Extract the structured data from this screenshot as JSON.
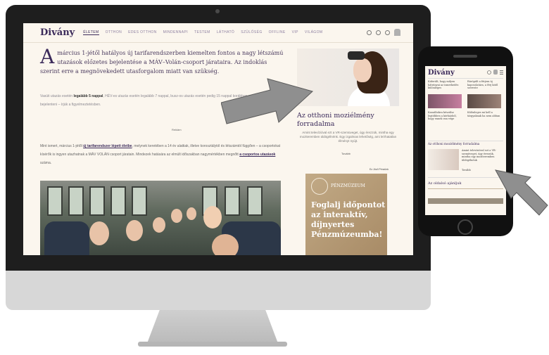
{
  "site": {
    "logo": "Divány",
    "nav_items": [
      "ÉLETEM",
      "OTTHON",
      "EDES OTTHON",
      "MINDENNAPI",
      "TESTEM",
      "LÁTHATÓ",
      "SZÜLŐSÉG",
      "OFFLINE",
      "VIP",
      "VILÁGOM"
    ],
    "active_nav": "ÉLETEM"
  },
  "article": {
    "dropcap": "A",
    "lead": "március 1-jétől hatályos új tarifarendszerben kiemelten fontos a nagy létszámú utazások előzetes bejelentése a MÁV–Volán-csoport járataira. Az indoklás szerint erre a megnövekedett utasforgalom miatt van szükség.",
    "para1_pre": "Vasúti utazás esetén ",
    "para1_bold": "legalább 5 nappal",
    "para1_post": ", HÉV-es utazás esetén legalább 7 nappal, busz-os utazás esetén pedig 15 nappal korábban szükségeses bejelenteni – írják a figyelmeztetésben.",
    "caption": "Reklám",
    "para2_a": "Mint ismert, március 1-jétől ",
    "para2_link1": "új tarifarendszer lépett életbe",
    "para2_b": ", melynek keretében a 14 év alattiak, illetve korosztálytól és létszámtól függően – a csoportokat kísérők is ingyen utazhatnak a MÁV VOLÁN csoport járatain. Mindezek hatására az elmúlt időszakban nagymértékben megnőtt ",
    "para2_link2": "a csoportos utazások",
    "para2_c": " száma."
  },
  "feature": {
    "title": "Az otthoni moziélmény forradalma",
    "text": "Amint televízióval ezt a VR-szemüveget, úgy érezzük, mintha egy moziteremben üldögélnénk. Egy izgalmas lehetőség, ami leírhatatlan élményt nyújt.",
    "more": "Tovább",
    "sponsor": "Ez Jövő Pénzünk"
  },
  "ad": {
    "brand": "PÉNZMÚZEUM",
    "headline": "Foglalj időpontot az interaktív, díjnyertes Pénzmúzeumba!"
  },
  "phone": {
    "logo": "Divány",
    "item1": "Kiderült, hogy milyen hátrányai az ismerkedés különleges",
    "item2": "Ráröpült a férjem új kapcsolatára, a férj kitől szerezte",
    "item3": "Kaszáltokra készülsz legtöbben a kórházból, hogy ennek van vége",
    "item4": "Különleges mi kell a tárgyaknak ha nem abban",
    "feature_label": "Az otthoni moziélmény forradalma",
    "feature_text": "Amint televízióval ezt a VR-szemüveget, úgy érezzük, mintha egy moziteremben üldögélnénk",
    "more": "Tovább",
    "section": "Az oldalsó ajánljuk"
  },
  "colors": {
    "brand_purple": "#3b2a5a",
    "page_bg": "#fbf6ee",
    "ad_gold": "#b69a73"
  }
}
